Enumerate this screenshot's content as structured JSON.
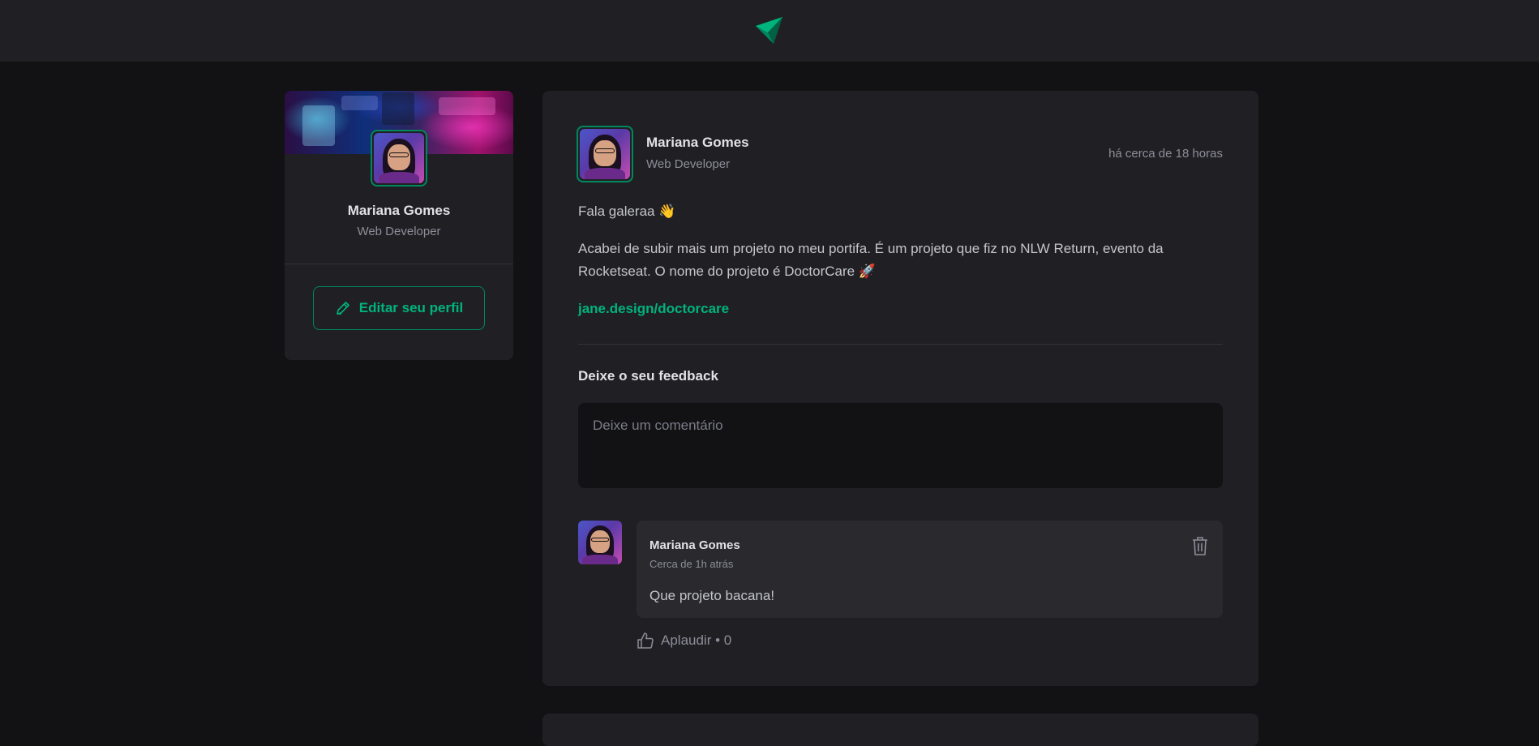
{
  "header": {
    "logo_icon": "ignite-logo-icon"
  },
  "sidebar": {
    "name": "Mariana Gomes",
    "role": "Web Developer",
    "edit_button_label": "Editar seu perfil",
    "edit_icon": "pencil-icon"
  },
  "post": {
    "author": {
      "name": "Mariana Gomes",
      "role": "Web Developer"
    },
    "time": "há cerca de 18 horas",
    "content": {
      "greeting": "Fala galeraa 👋",
      "paragraph": "Acabei de subir mais um projeto no meu portifa. É um projeto que fiz no NLW Return, evento da Rocketseat. O nome do projeto é DoctorCare 🚀",
      "link": "jane.design/doctorcare"
    },
    "feedback": {
      "title": "Deixe o seu feedback",
      "placeholder": "Deixe um comentário"
    },
    "comments": [
      {
        "author": "Mariana Gomes",
        "time": "Cerca de 1h atrás",
        "text": "Que projeto bacana!",
        "applaud_label": "Aplaudir • 0"
      }
    ]
  },
  "colors": {
    "background": "#121214",
    "surface": "#202024",
    "accent": "#00875f",
    "accent_light": "#00b37e"
  }
}
